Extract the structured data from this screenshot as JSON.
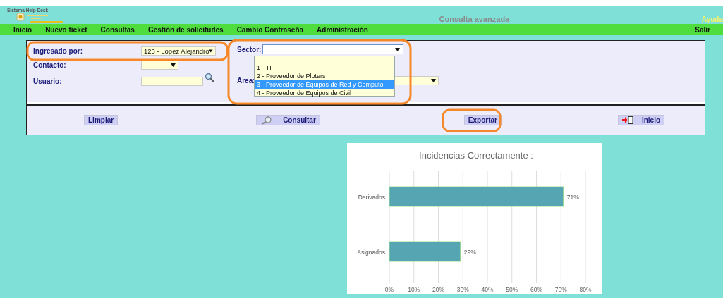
{
  "header": {
    "system_name": "Sistema Help Desk",
    "title": "Consulta avanzada",
    "help_link": "Ayuda"
  },
  "nav": {
    "items": [
      "Inicio",
      "Nuevo ticket",
      "Consultas",
      "Gestión de solicitudes",
      "Cambio Contraseña",
      "Administración"
    ],
    "logout": "Salir"
  },
  "form": {
    "fields": [
      {
        "label": "Ingresado por:",
        "kind": "select",
        "value": "123 - Lopez Alejandro"
      },
      {
        "label": "Contacto:",
        "kind": "select"
      },
      {
        "label": "Usuario:",
        "kind": "search"
      }
    ],
    "sector": {
      "label": "Sector:",
      "expanded": true,
      "options": [
        {
          "label": "1 - TI",
          "selected": false
        },
        {
          "label": "2 - Proveedor de Ploters",
          "selected": false
        },
        {
          "label": "3 - Proveedor de Equipos de Red y Computo",
          "selected": true
        },
        {
          "label": "4 - Proveedor de Equipos de Civil",
          "selected": false
        }
      ]
    },
    "area": {
      "label": "Area:"
    }
  },
  "buttons": [
    {
      "label": "Limpiar",
      "kind": "plain"
    },
    {
      "label": "Consultar",
      "kind": "search"
    },
    {
      "label": "Exportar",
      "kind": "plain"
    },
    {
      "label": "Inicio",
      "kind": "exit"
    }
  ],
  "chart": {
    "chart_data": {
      "type": "bar",
      "orientation": "horizontal",
      "title": "Incidencias Correctamente :",
      "categories": [
        "Derivados",
        "Asignados"
      ],
      "series": [
        {
          "color": "#55a5b3",
          "values": [
            71,
            29
          ]
        }
      ],
      "grid": true,
      "xlim": [
        0,
        80
      ],
      "xticks": [
        {
          "value": 0,
          "label": "0%"
        },
        {
          "value": 10,
          "label": "10%"
        },
        {
          "value": 20,
          "label": "20%"
        },
        {
          "value": 30,
          "label": "30%"
        },
        {
          "value": 40,
          "label": "40%"
        },
        {
          "value": 50,
          "label": "50%"
        },
        {
          "value": 60,
          "label": "60%"
        },
        {
          "value": 70,
          "label": "70%"
        },
        {
          "value": 80,
          "label": "80%"
        }
      ],
      "value_labels": [
        "71%",
        "29%"
      ]
    }
  }
}
